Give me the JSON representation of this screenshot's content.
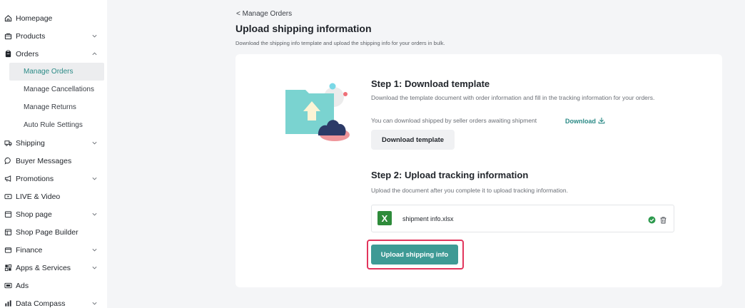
{
  "sidebar": {
    "items": [
      {
        "label": "Homepage",
        "icon": "home-icon",
        "chevron": ""
      },
      {
        "label": "Products",
        "icon": "bag-icon",
        "chevron": "down"
      },
      {
        "label": "Orders",
        "icon": "clipboard-icon",
        "chevron": "up"
      }
    ],
    "orders_subitems": [
      {
        "label": "Manage Orders",
        "active": true
      },
      {
        "label": "Manage Cancellations",
        "active": false
      },
      {
        "label": "Manage Returns",
        "active": false
      },
      {
        "label": "Auto Rule Settings",
        "active": false
      }
    ],
    "more_items": [
      {
        "label": "Shipping",
        "icon": "truck-icon",
        "chevron": "down"
      },
      {
        "label": "Buyer Messages",
        "icon": "chat-icon",
        "chevron": ""
      },
      {
        "label": "Promotions",
        "icon": "megaphone-icon",
        "chevron": "down"
      },
      {
        "label": "LIVE & Video",
        "icon": "live-icon",
        "chevron": ""
      },
      {
        "label": "Shop page",
        "icon": "shop-icon",
        "chevron": "down"
      },
      {
        "label": "Shop Page Builder",
        "icon": "builder-icon",
        "chevron": ""
      },
      {
        "label": "Finance",
        "icon": "wallet-icon",
        "chevron": "down"
      },
      {
        "label": "Apps & Services",
        "icon": "apps-icon",
        "chevron": "down"
      },
      {
        "label": "Ads",
        "icon": "ads-icon",
        "chevron": ""
      },
      {
        "label": "Data Compass",
        "icon": "chart-icon",
        "chevron": "down"
      }
    ]
  },
  "header": {
    "breadcrumb": "< Manage Orders",
    "title": "Upload shipping information",
    "description": "Download the shipping info template and upload the shipping info for your orders in bulk."
  },
  "step1": {
    "title": "Step 1: Download template",
    "text1": "Download the template document with order information and fill in the tracking information for your orders.",
    "text2": "You can download shipped by seller orders awaiting shipment",
    "download_link": "Download",
    "button": "Download template"
  },
  "step2": {
    "title": "Step 2: Upload tracking information",
    "text": "Upload the document after you complete it to upload tracking information.",
    "file_icon_letter": "X",
    "file_name": "shipment info.xlsx",
    "upload_button": "Upload shipping info"
  },
  "colors": {
    "accent": "#3e9a95",
    "highlight": "#e2355c",
    "file_icon": "#2e8b3a",
    "success": "#2e9a4e"
  }
}
